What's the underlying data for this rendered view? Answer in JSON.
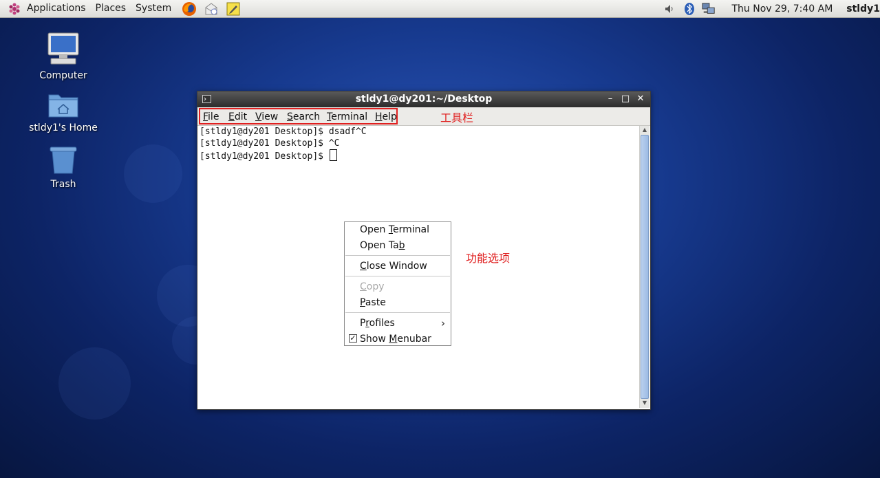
{
  "top_panel": {
    "menus": [
      "Applications",
      "Places",
      "System"
    ],
    "launchers": [
      "firefox-icon",
      "mail-icon",
      "notes-icon"
    ],
    "tray": [
      "volume-icon",
      "bluetooth-icon",
      "network-icon"
    ],
    "clock": "Thu Nov 29,  7:40 AM",
    "user": "stldy1"
  },
  "desktop_icons": [
    {
      "label": "Computer",
      "icon": "computer-icon"
    },
    {
      "label": "stldy1's Home",
      "icon": "home-folder-icon"
    },
    {
      "label": "Trash",
      "icon": "trash-icon"
    }
  ],
  "terminal": {
    "title": "stldy1@dy201:~/Desktop",
    "menubar": [
      {
        "label": "File",
        "mnemonic": "F",
        "rest": "ile"
      },
      {
        "label": "Edit",
        "mnemonic": "E",
        "rest": "dit"
      },
      {
        "label": "View",
        "mnemonic": "V",
        "rest": "iew"
      },
      {
        "label": "Search",
        "mnemonic": "S",
        "rest": "earch"
      },
      {
        "label": "Terminal",
        "mnemonic": "T",
        "rest": "erminal"
      },
      {
        "label": "Help",
        "mnemonic": "H",
        "rest": "elp"
      }
    ],
    "lines": [
      "[stldy1@dy201 Desktop]$ dsadf^C",
      "[stldy1@dy201 Desktop]$ ^C",
      "[stldy1@dy201 Desktop]$ "
    ]
  },
  "context_menu": {
    "open_terminal": {
      "pre": "Open ",
      "mnemonic": "T",
      "post": "erminal"
    },
    "open_tab": {
      "pre": "Open Ta",
      "mnemonic": "b",
      "post": ""
    },
    "close_window": {
      "pre": "",
      "mnemonic": "C",
      "post": "lose Window"
    },
    "copy": {
      "pre": "",
      "mnemonic": "C",
      "post": "opy"
    },
    "paste": {
      "pre": "",
      "mnemonic": "P",
      "post": "aste"
    },
    "profiles": {
      "pre": "P",
      "mnemonic": "r",
      "post": "ofiles"
    },
    "show_menubar": {
      "pre": "Show ",
      "mnemonic": "M",
      "post": "enubar"
    },
    "show_menubar_checked": true
  },
  "annotations": {
    "toolbar": "工具栏",
    "features": "功能选项"
  }
}
